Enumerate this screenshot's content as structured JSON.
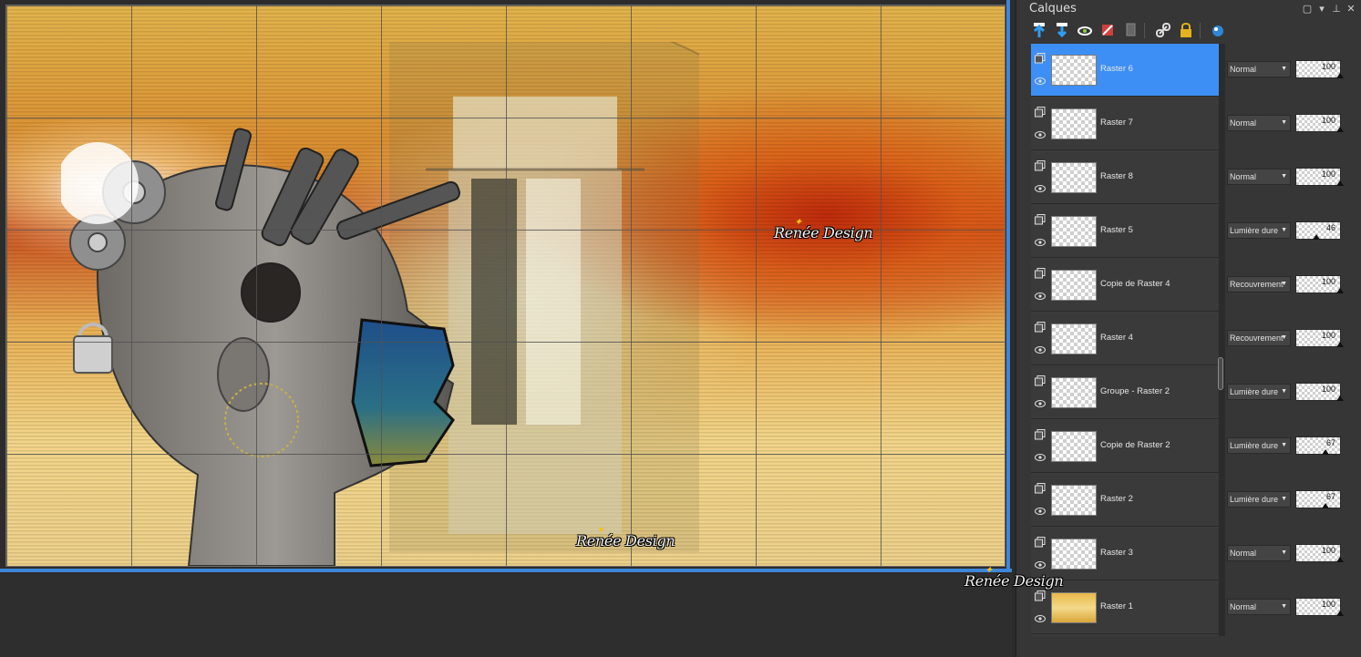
{
  "panel": {
    "title": "Calques",
    "title_buttons": [
      "restore-icon",
      "menu-arrow-icon",
      "pin-icon",
      "close-icon"
    ],
    "toolbar": [
      "new-raster-layer-icon",
      "new-vector-layer-icon",
      "new-mask-icon",
      "delete-layer-icon",
      "duplicate-layer-icon",
      "link-icon",
      "lock-icon",
      "layer-effects-icon"
    ]
  },
  "layers": [
    {
      "name": "Raster 6",
      "blend": "Normal",
      "opacity": 100,
      "selected": true,
      "thumb": "empty"
    },
    {
      "name": "Raster 7",
      "blend": "Normal",
      "opacity": 100,
      "selected": false,
      "thumb": "figure"
    },
    {
      "name": "Raster 8",
      "blend": "Normal",
      "opacity": 100,
      "selected": false,
      "thumb": "small"
    },
    {
      "name": "Raster 5",
      "blend": "Lumière dure",
      "opacity": 46,
      "selected": false,
      "thumb": "soft"
    },
    {
      "name": "Copie de Raster 4",
      "blend": "Recouvrement",
      "opacity": 100,
      "selected": false,
      "thumb": "band"
    },
    {
      "name": "Raster 4",
      "blend": "Recouvrement",
      "opacity": 100,
      "selected": false,
      "thumb": "band"
    },
    {
      "name": "Groupe - Raster 2",
      "blend": "Lumière dure",
      "opacity": 100,
      "selected": false,
      "thumb": "pale"
    },
    {
      "name": "Copie de Raster 2",
      "blend": "Lumière dure",
      "opacity": 67,
      "selected": false,
      "thumb": "door"
    },
    {
      "name": "Raster 2",
      "blend": "Lumière dure",
      "opacity": 67,
      "selected": false,
      "thumb": "door"
    },
    {
      "name": "Raster 3",
      "blend": "Normal",
      "opacity": 100,
      "selected": false,
      "thumb": "empty"
    },
    {
      "name": "Raster 1",
      "blend": "Normal",
      "opacity": 100,
      "selected": false,
      "thumb": "gold"
    }
  ],
  "canvas": {
    "watermarks": [
      "Renée Design",
      "Renée Design",
      "Renée Design"
    ]
  },
  "colors": {
    "selection": "#3d8ff5",
    "canvas_border": "#3e86d8",
    "panel_bg": "#363636"
  }
}
